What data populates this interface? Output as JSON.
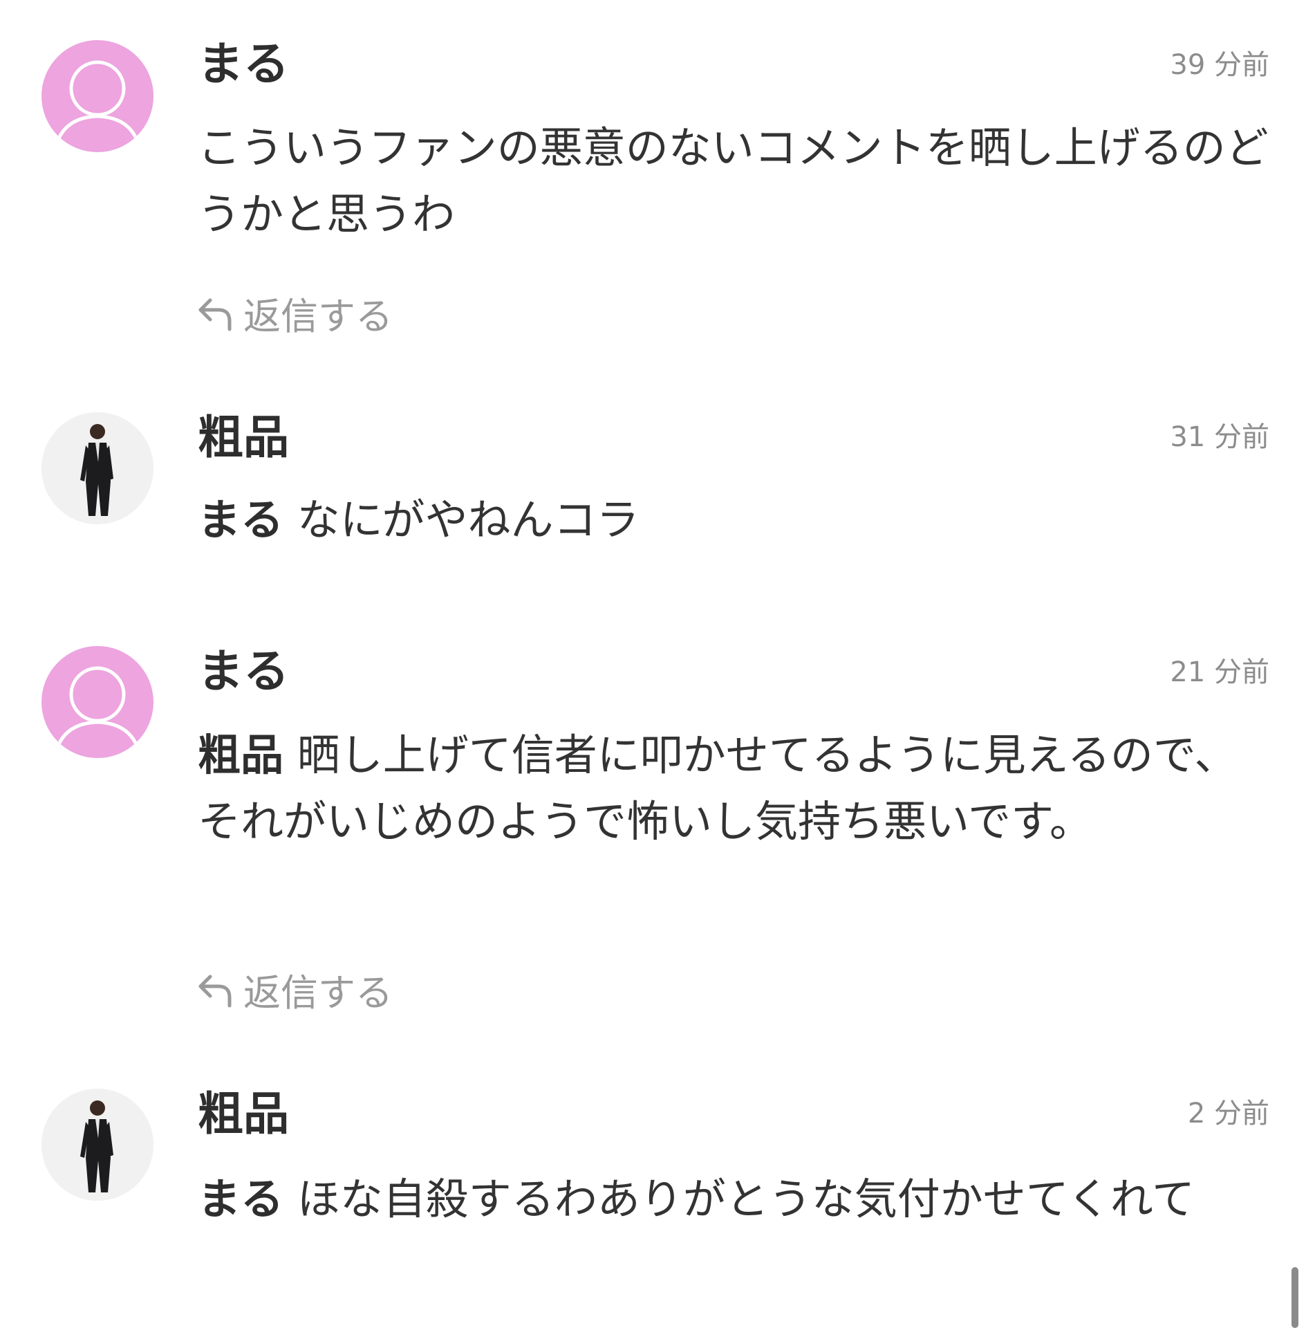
{
  "comments": [
    {
      "author": "まる",
      "time": "39 分前",
      "mention": "",
      "text": "こういうファンの悪意のないコメントを晒し上げるのどうかと思うわ",
      "reply_label": "返信する",
      "avatar": "default-avatar"
    },
    {
      "author": "粗品",
      "time": "31 分前",
      "mention": "まる",
      "text": "なにがやねんコラ",
      "avatar": "profile-photo"
    },
    {
      "author": "まる",
      "time": "21 分前",
      "mention": "粗品",
      "text": "晒し上げて信者に叩かせてるように見えるので、それがいじめのようで怖いし気持ち悪いです。",
      "reply_label": "返信する",
      "avatar": "default-avatar"
    },
    {
      "author": "粗品",
      "time": "2 分前",
      "mention": "まる",
      "text": "ほな自殺するわありがとうな気付かせてくれて",
      "avatar": "profile-photo"
    }
  ],
  "colors": {
    "default_avatar_bg": "#eda4df",
    "muted_text": "#8c8c8c",
    "reply_text": "#9a9a9a"
  },
  "icons": {
    "reply": "reply-arrow-icon",
    "default_avatar": "person-silhouette-icon"
  }
}
